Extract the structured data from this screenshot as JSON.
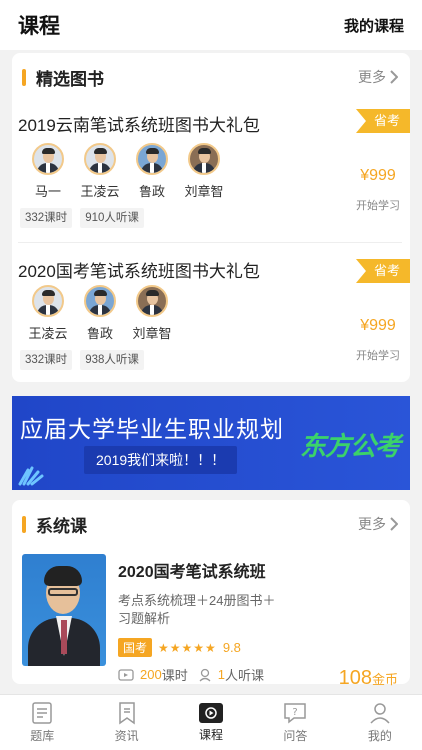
{
  "header": {
    "title": "课程",
    "my_courses": "我的课程"
  },
  "books_section": {
    "title": "精选图书",
    "more": "更多",
    "items": [
      {
        "title": "2019云南笔试系统班图书大礼包",
        "tag": "省考",
        "teachers": [
          "马一",
          "王凌云",
          "鲁政",
          "刘章智"
        ],
        "hours": "332课时",
        "listeners": "910人听课",
        "price": "¥999",
        "action": "开始学习"
      },
      {
        "title": "2020国考笔试系统班图书大礼包",
        "tag": "省考",
        "teachers": [
          "王凌云",
          "鲁政",
          "刘章智"
        ],
        "hours": "332课时",
        "listeners": "938人听课",
        "price": "¥999",
        "action": "开始学习"
      }
    ]
  },
  "banner": {
    "title": "应届大学毕业生职业规划",
    "subtitle": "2019我们来啦！！！",
    "logo": "东方公考"
  },
  "system_section": {
    "title": "系统课",
    "more": "更多",
    "course": {
      "title": "2020国考笔试系统班",
      "desc": "考点系统梳理＋24册图书＋习题解析",
      "tag": "国考",
      "stars": "★★★★★",
      "rating": "9.8",
      "hours_num": "200",
      "hours_unit": "课时",
      "listeners_num": "1",
      "listeners_unit": "人听课",
      "price": "108",
      "price_unit": "金币"
    }
  },
  "tabbar": [
    {
      "label": "题库",
      "icon": "question-bank-icon"
    },
    {
      "label": "资讯",
      "icon": "news-icon"
    },
    {
      "label": "课程",
      "icon": "course-play-icon",
      "active": true
    },
    {
      "label": "问答",
      "icon": "qa-icon"
    },
    {
      "label": "我的",
      "icon": "profile-icon"
    }
  ],
  "colors": {
    "accent": "#f5a623",
    "banner": "#2046c8",
    "logo": "#3bd26a"
  }
}
